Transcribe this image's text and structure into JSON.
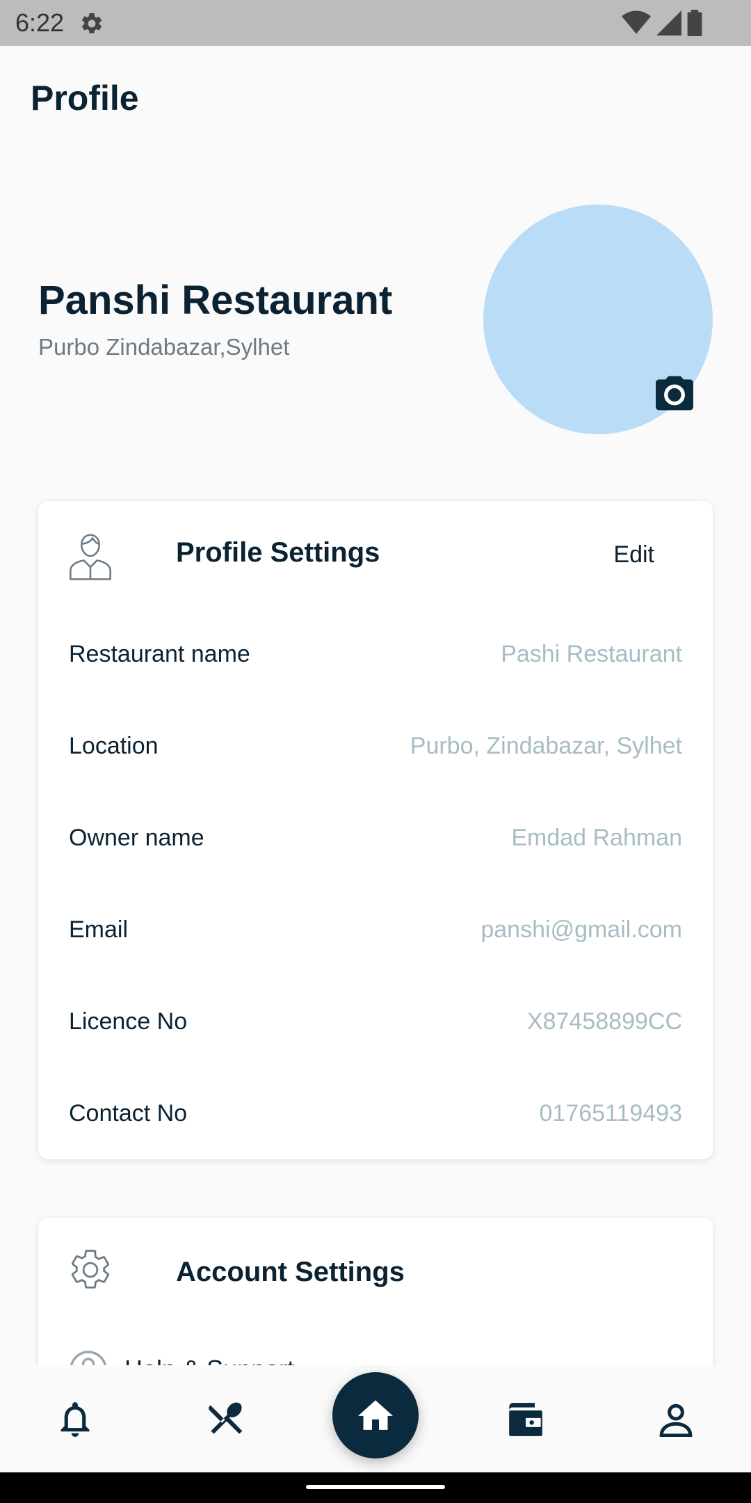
{
  "status_bar": {
    "time": "6:22",
    "icons": [
      "gear-icon",
      "wifi-icon",
      "signal-icon",
      "battery-icon"
    ]
  },
  "header": {
    "title": "Profile"
  },
  "profile": {
    "name": "Panshi Restaurant",
    "address": "Purbo Zindabazar,Sylhet",
    "avatar_color": "#b9dcf7",
    "camera_icon": "camera-icon"
  },
  "profile_settings": {
    "title": "Profile Settings",
    "icon": "user-icon",
    "edit_label": "Edit",
    "fields": [
      {
        "label": "Restaurant name",
        "value": "Pashi Restaurant"
      },
      {
        "label": "Location",
        "value": "Purbo, Zindabazar, Sylhet"
      },
      {
        "label": "Owner name",
        "value": "Emdad Rahman"
      },
      {
        "label": "Email",
        "value": "panshi@gmail.com"
      },
      {
        "label": "Licence No",
        "value": "X87458899CC"
      },
      {
        "label": "Contact No",
        "value": "01765119493"
      }
    ]
  },
  "account_settings": {
    "title": "Account Settings",
    "icon": "gear-icon",
    "items": [
      {
        "label": "Help & Support",
        "icon": "help-icon"
      }
    ]
  },
  "bottom_nav": {
    "items": [
      "bell-icon",
      "utensils-icon",
      "home-icon",
      "wallet-icon",
      "person-icon"
    ],
    "active": "home-icon",
    "active_color": "#0b2a3d"
  },
  "colors": {
    "primary": "#0b2233",
    "value_text": "#a8bcc4",
    "status_bar": "#bcbcbc"
  }
}
